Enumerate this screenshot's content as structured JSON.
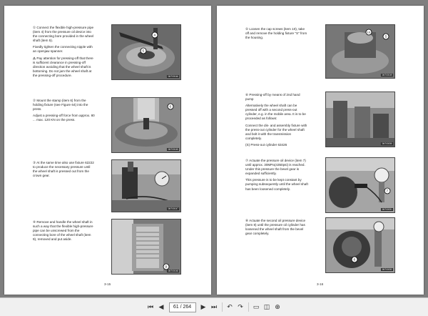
{
  "left_page": {
    "steps": [
      {
        "num": "①",
        "paras": [
          "Connect the flexible high-pressure pipe (item 4) from the pressure oil device into the connecting bore provided in the wheel shaft (item 5).",
          "Fixedly tighten the connecting nipple with an openjaw spanner."
        ],
        "note_symbol": "⚠",
        "note": "Pay attention for pressing-off that there is sufficient clearance in pressing-off direction avoiding that the wheel shaft is bottoming. Do not jam the wheel shaft at the pressing-off procedure.",
        "photo_label": "4 5",
        "code": "3M700046"
      },
      {
        "num": "②",
        "paras": [
          "Mount the stamp (item 6) from the holding fixture (see Figure 64) into the press.",
          "Adjust a pressing-off force from approx. 80 ... max. 120 KN on the press."
        ],
        "photo_label": "6",
        "code": "3M700045"
      },
      {
        "num": "③",
        "paras": [
          "At the same time also use fixture 62222 to produce the necessary pressure until the wheel shaft is pressed out from the crown gear."
        ],
        "photo_label": "",
        "code": "3M700047"
      },
      {
        "num": "④",
        "paras": [
          "Remove and handle the wheel shaft in such a way that the flexible high-pressure pipe can be unscrewed from the connecting bore of the wheel shaft (item 9), removed and put aside."
        ],
        "photo_label": "9",
        "code": "3M700048"
      }
    ],
    "page_number": "3-15"
  },
  "right_page": {
    "steps": [
      {
        "num": "⑤",
        "paras": [
          "Loosen the cap screws (item 10), take off and remove the holding fixture \"S\" from the housing."
        ],
        "photo_label": "10 S",
        "code": "3M700049"
      },
      {
        "num": "⑥",
        "paras": [
          "Pressing-off by means of 2nd hand pump",
          "Alternatively the wheel shaft can be pressed off with a second press-out cylinder, e.g. in the mobile area. It is to be proceeded as follows:",
          "Connect the dis- and assembly fixture with the press-out cylinder for the wheel shaft and bolt it with the transmission completely.",
          "(S) Press-out cylinder 63426"
        ],
        "photo_label": "",
        "code": "3M700050"
      },
      {
        "num": "⑦",
        "paras": [
          "Actuate the pressure oil device (item 7) until approx. 30MPa(4350psi) is reached. Under this pressure the bevel gear is expanded sufficiently.",
          "This pressure is to be kept constant by pumping subsequently until the wheel shaft has been loosened completely."
        ],
        "photo_label": "7",
        "code": "3M700051"
      },
      {
        "num": "⑧",
        "paras": [
          "Actuate the second oil pressure device (item 8) until the pressure oil cylinder has loosened the wheel shaft from the bevel gear completely."
        ],
        "photo_label": "8",
        "code": "3M700052"
      }
    ],
    "page_number": "3-16"
  },
  "toolbar": {
    "current_page": "61",
    "total_pages": "264",
    "page_display": "61 / 264"
  }
}
